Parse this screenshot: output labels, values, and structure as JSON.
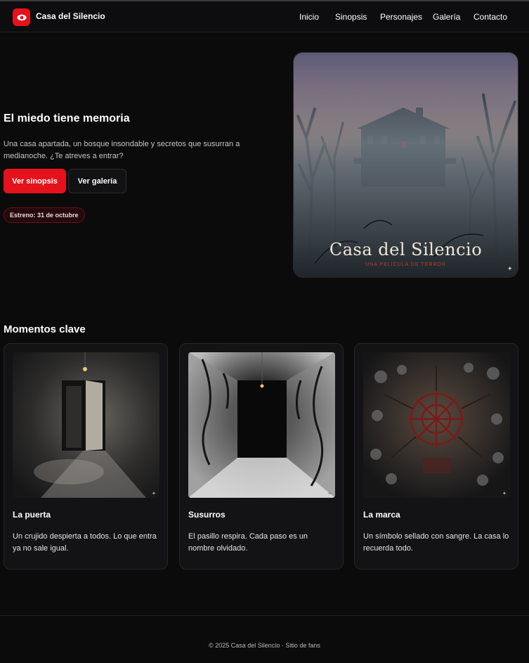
{
  "header": {
    "brand": "Casa del Silencio",
    "nav": [
      "Inicio",
      "Sinopsis",
      "Personajes",
      "Galería",
      "Contacto"
    ]
  },
  "hero": {
    "title": "El miedo tiene memoria",
    "text": "Una casa apartada, un bosque insondable y secretos que susurran a medianoche. ¿Te atreves a entrar?",
    "primary_button": "Ver sinopsis",
    "secondary_button": "Ver galería",
    "badge": "Estreno: 31 de octubre",
    "poster": {
      "title": "Casa del Silencio",
      "subtitle": "UNA PELÍCULA DE TERROR"
    }
  },
  "moments": {
    "title": "Momentos clave",
    "cards": [
      {
        "title": "La puerta",
        "text": "Un crujido despierta a todos. Lo que entra ya no sale igual.",
        "image": "open-door-image"
      },
      {
        "title": "Susurros",
        "text": "El pasillo respira. Cada paso es un nombre olvidado.",
        "image": "corridor-image"
      },
      {
        "title": "La marca",
        "text": "Un símbolo sellado con sangre. La casa lo recuerda todo.",
        "image": "symbol-image"
      }
    ]
  },
  "footer": {
    "text": "© 2025 Casa del Silencio · Sitio de fans"
  },
  "colors": {
    "accent": "#e5121b",
    "background": "#0b0b0c",
    "card": "#131316"
  }
}
